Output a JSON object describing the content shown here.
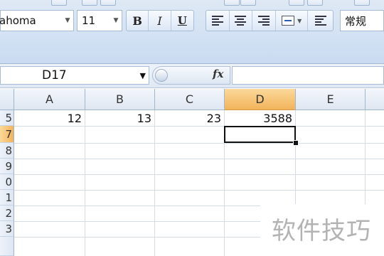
{
  "ribbon": {
    "font_name": "ahoma",
    "font_size": "11",
    "bold_label": "B",
    "italic_label": "I",
    "underline_label": "U",
    "number_format": "常规"
  },
  "formula_bar": {
    "name_box": "D17",
    "fx_label": "fx",
    "formula": ""
  },
  "sheet": {
    "columns": [
      "A",
      "B",
      "C",
      "D",
      "E"
    ],
    "active_column": "D",
    "rows": [
      "5",
      "7",
      "8",
      "9",
      "0",
      "1",
      "2",
      "3"
    ],
    "active_row": "7",
    "cells": {
      "A5": "12",
      "B5": "13",
      "C5": "23",
      "D5": "3588"
    }
  },
  "watermark": "软件技巧",
  "colors": {
    "ribbon": "#d5e3f4",
    "active_header": "#f2b35a",
    "grid_line": "#d6dce4",
    "selection_border": "#111111"
  }
}
